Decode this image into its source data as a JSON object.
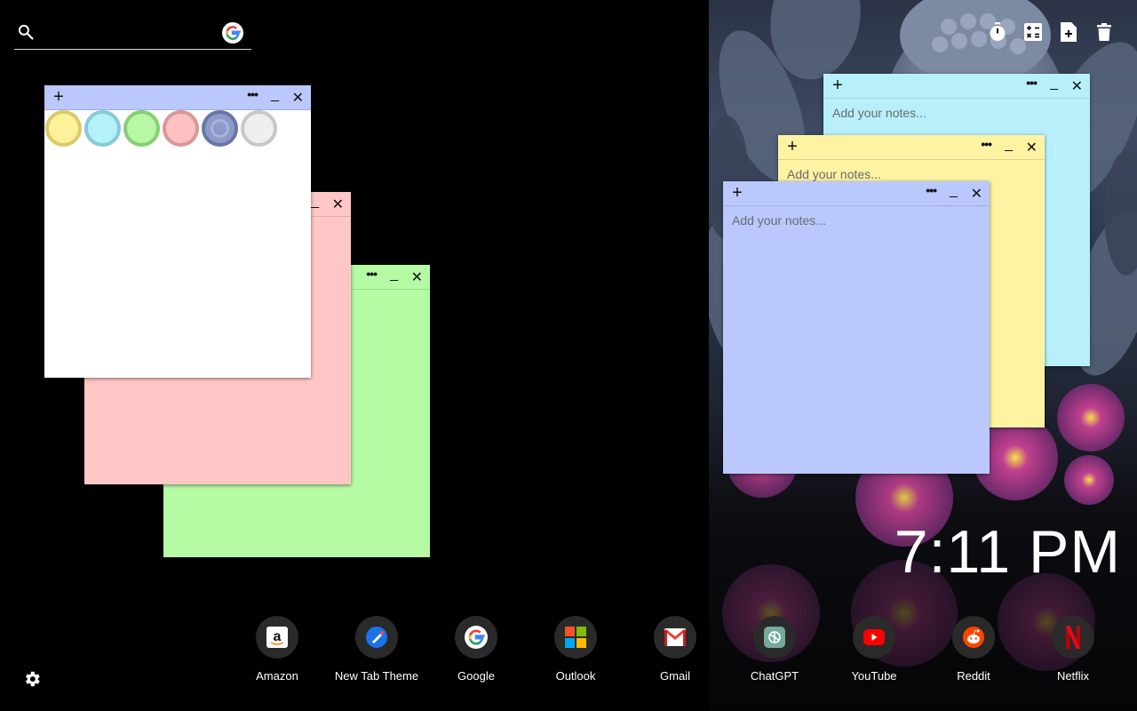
{
  "search": {
    "value": "",
    "placeholder": ""
  },
  "tools": [
    {
      "name": "timer-icon"
    },
    {
      "name": "calculator-icon"
    },
    {
      "name": "add-note-icon"
    },
    {
      "name": "trash-icon"
    }
  ],
  "notes": {
    "add_glyph": "+",
    "more_glyph": "•••",
    "minimize_glyph": "_",
    "close_glyph": "✕",
    "placeholder": "Add your notes..."
  },
  "palette_colors": [
    {
      "fill": "#fdf19a",
      "ring": "#d8cb6c"
    },
    {
      "fill": "#b5f1fb",
      "ring": "#86cbd6"
    },
    {
      "fill": "#b7f8a4",
      "ring": "#86cf74"
    },
    {
      "fill": "#ffc1c1",
      "ring": "#d99797"
    },
    {
      "fill": "#8e9ac9",
      "ring": "#6a76a6"
    },
    {
      "fill": "#efefef",
      "ring": "#c8c8c8"
    }
  ],
  "colors": {
    "yellow": "#fdf3a3",
    "cyan": "#b7f0fb",
    "green": "#b5fba4",
    "pink": "#ffc6c6",
    "lavender": "#bac8fd",
    "white": "#ffffff"
  },
  "clock": "7:11 PM",
  "shortcuts": [
    {
      "label": "Amazon",
      "icon": "amazon-icon"
    },
    {
      "label": "New Tab Theme",
      "icon": "new-tab-theme-icon"
    },
    {
      "label": "Google",
      "icon": "google-icon"
    },
    {
      "label": "Outlook",
      "icon": "outlook-icon"
    },
    {
      "label": "Gmail",
      "icon": "gmail-icon"
    },
    {
      "label": "ChatGPT",
      "icon": "chatgpt-icon"
    },
    {
      "label": "YouTube",
      "icon": "youtube-icon"
    },
    {
      "label": "Reddit",
      "icon": "reddit-icon"
    },
    {
      "label": "Netflix",
      "icon": "netflix-icon"
    }
  ]
}
